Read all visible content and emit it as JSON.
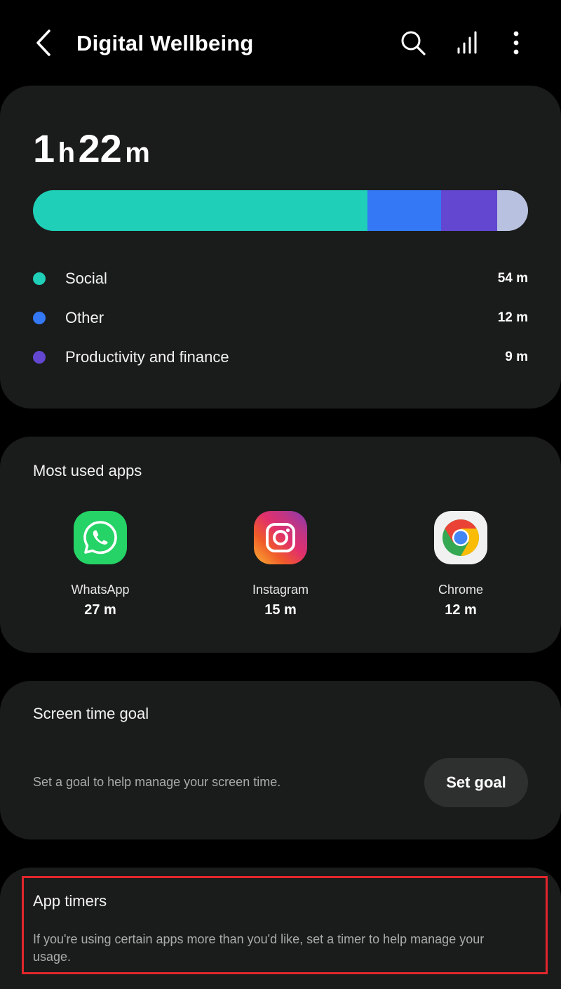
{
  "header": {
    "title": "Digital Wellbeing",
    "icons": [
      "back-chevron",
      "search-icon",
      "stats-icon",
      "more-vertical-icon"
    ]
  },
  "usage": {
    "total_hours": "1",
    "hours_unit": "h",
    "total_minutes": "22",
    "minutes_unit": "m",
    "bar_segments": [
      {
        "name": "Social",
        "minutes": 54,
        "color": "#1fcfb7"
      },
      {
        "name": "Other",
        "minutes": 12,
        "color": "#3478f6"
      },
      {
        "name": "Productivity and finance",
        "minutes": 9,
        "color": "#6347d0"
      },
      {
        "name": "remaining",
        "minutes": 5,
        "color": "#b8c2e0"
      }
    ],
    "legend": [
      {
        "label": "Social",
        "value": "54 m",
        "color": "#1fcfb7"
      },
      {
        "label": "Other",
        "value": "12 m",
        "color": "#3478f6"
      },
      {
        "label": "Productivity and finance",
        "value": "9 m",
        "color": "#6347d0"
      }
    ]
  },
  "most_used": {
    "title": "Most used apps",
    "apps": [
      {
        "name": "WhatsApp",
        "time": "27 m",
        "icon": "whatsapp-icon"
      },
      {
        "name": "Instagram",
        "time": "15 m",
        "icon": "instagram-icon"
      },
      {
        "name": "Chrome",
        "time": "12 m",
        "icon": "chrome-icon"
      }
    ]
  },
  "goal": {
    "title": "Screen time goal",
    "description": "Set a goal to help manage your screen time.",
    "button_label": "Set goal"
  },
  "timers": {
    "title": "App timers",
    "description": "If you're using certain apps more than you'd like, set a timer to help manage your usage."
  },
  "colors": {
    "background": "#000000",
    "card": "#1a1c1b",
    "highlight": "#e0262c"
  }
}
